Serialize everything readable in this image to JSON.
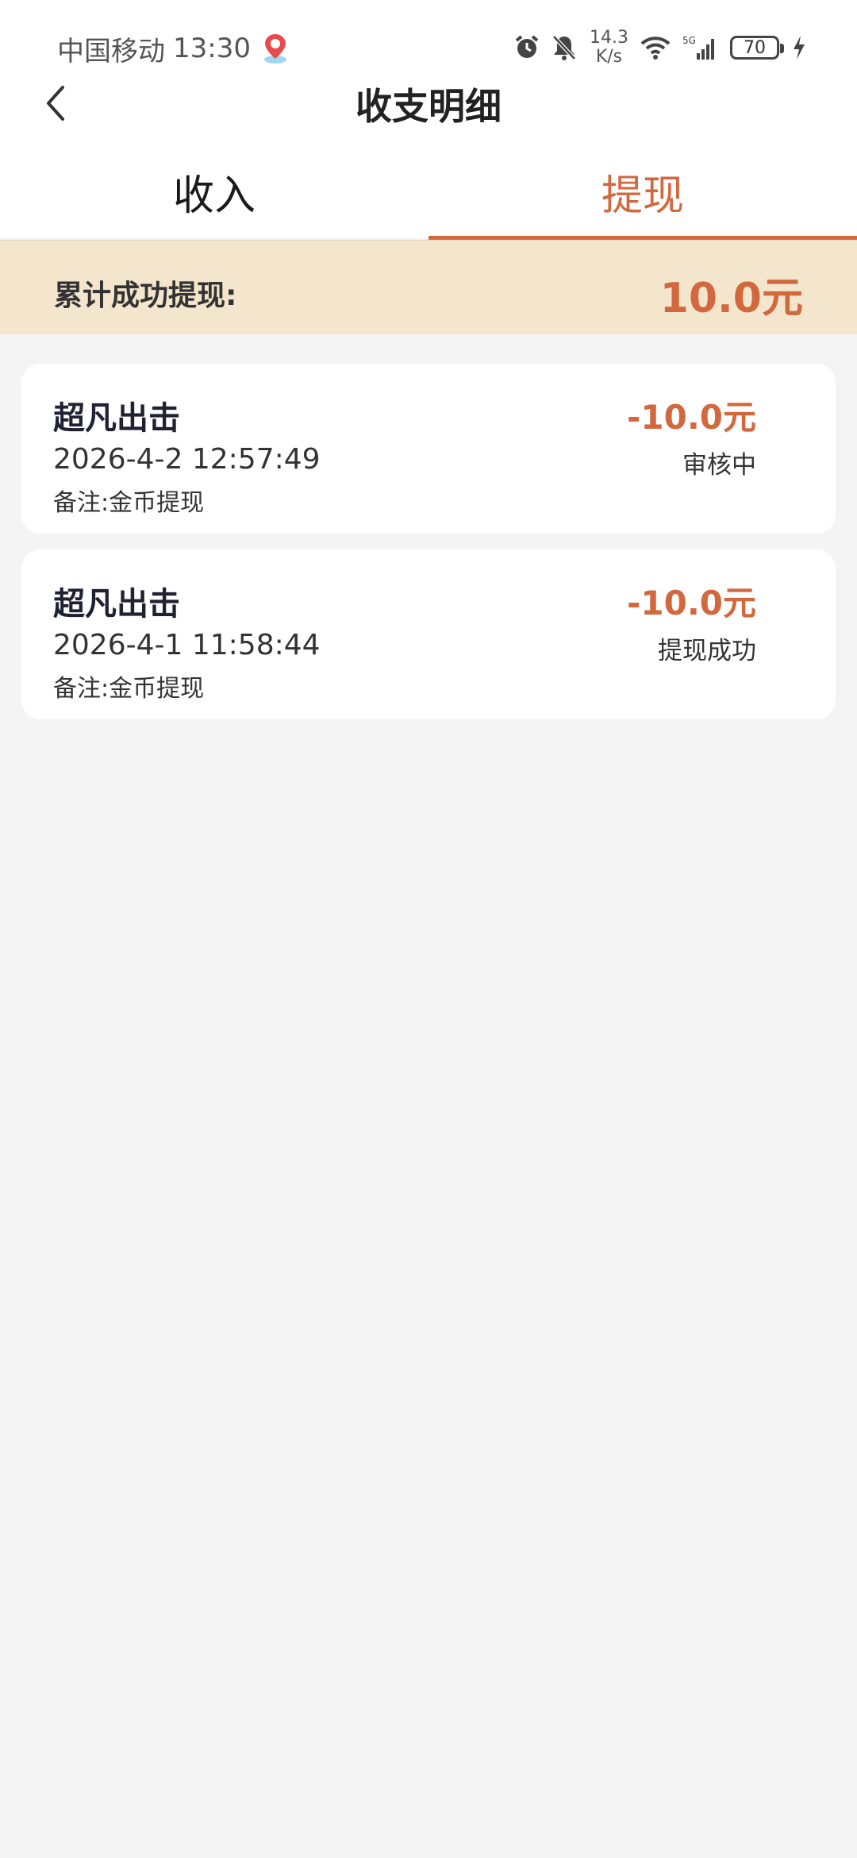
{
  "status_bar": {
    "carrier": "中国移动",
    "time": "13:30",
    "net_speed_value": "14.3",
    "net_speed_unit": "K/s",
    "battery": "70",
    "icons": [
      "alarm-icon",
      "mute-bell-icon",
      "wifi-icon",
      "signal-5g-icon",
      "battery-icon",
      "charging-icon",
      "location-pin-icon"
    ]
  },
  "header": {
    "title": "收支明细",
    "back_icon": "chevron-left-icon"
  },
  "tabs": [
    {
      "label": "收入",
      "active": false
    },
    {
      "label": "提现",
      "active": true
    }
  ],
  "summary": {
    "label": "累计成功提现:",
    "value": "10.0元"
  },
  "records": [
    {
      "title": "超凡出击",
      "time": "2026-4-2 12:57:49",
      "note": "备注:金币提现",
      "amount": "-10.0元",
      "status": "审核中"
    },
    {
      "title": "超凡出击",
      "time": "2026-4-1 11:58:44",
      "note": "备注:金币提现",
      "amount": "-10.0元",
      "status": "提现成功"
    }
  ],
  "colors": {
    "accent": "#d2683e",
    "summary_bg": "#f4e6cc",
    "page_bg": "#f4f4f4"
  }
}
